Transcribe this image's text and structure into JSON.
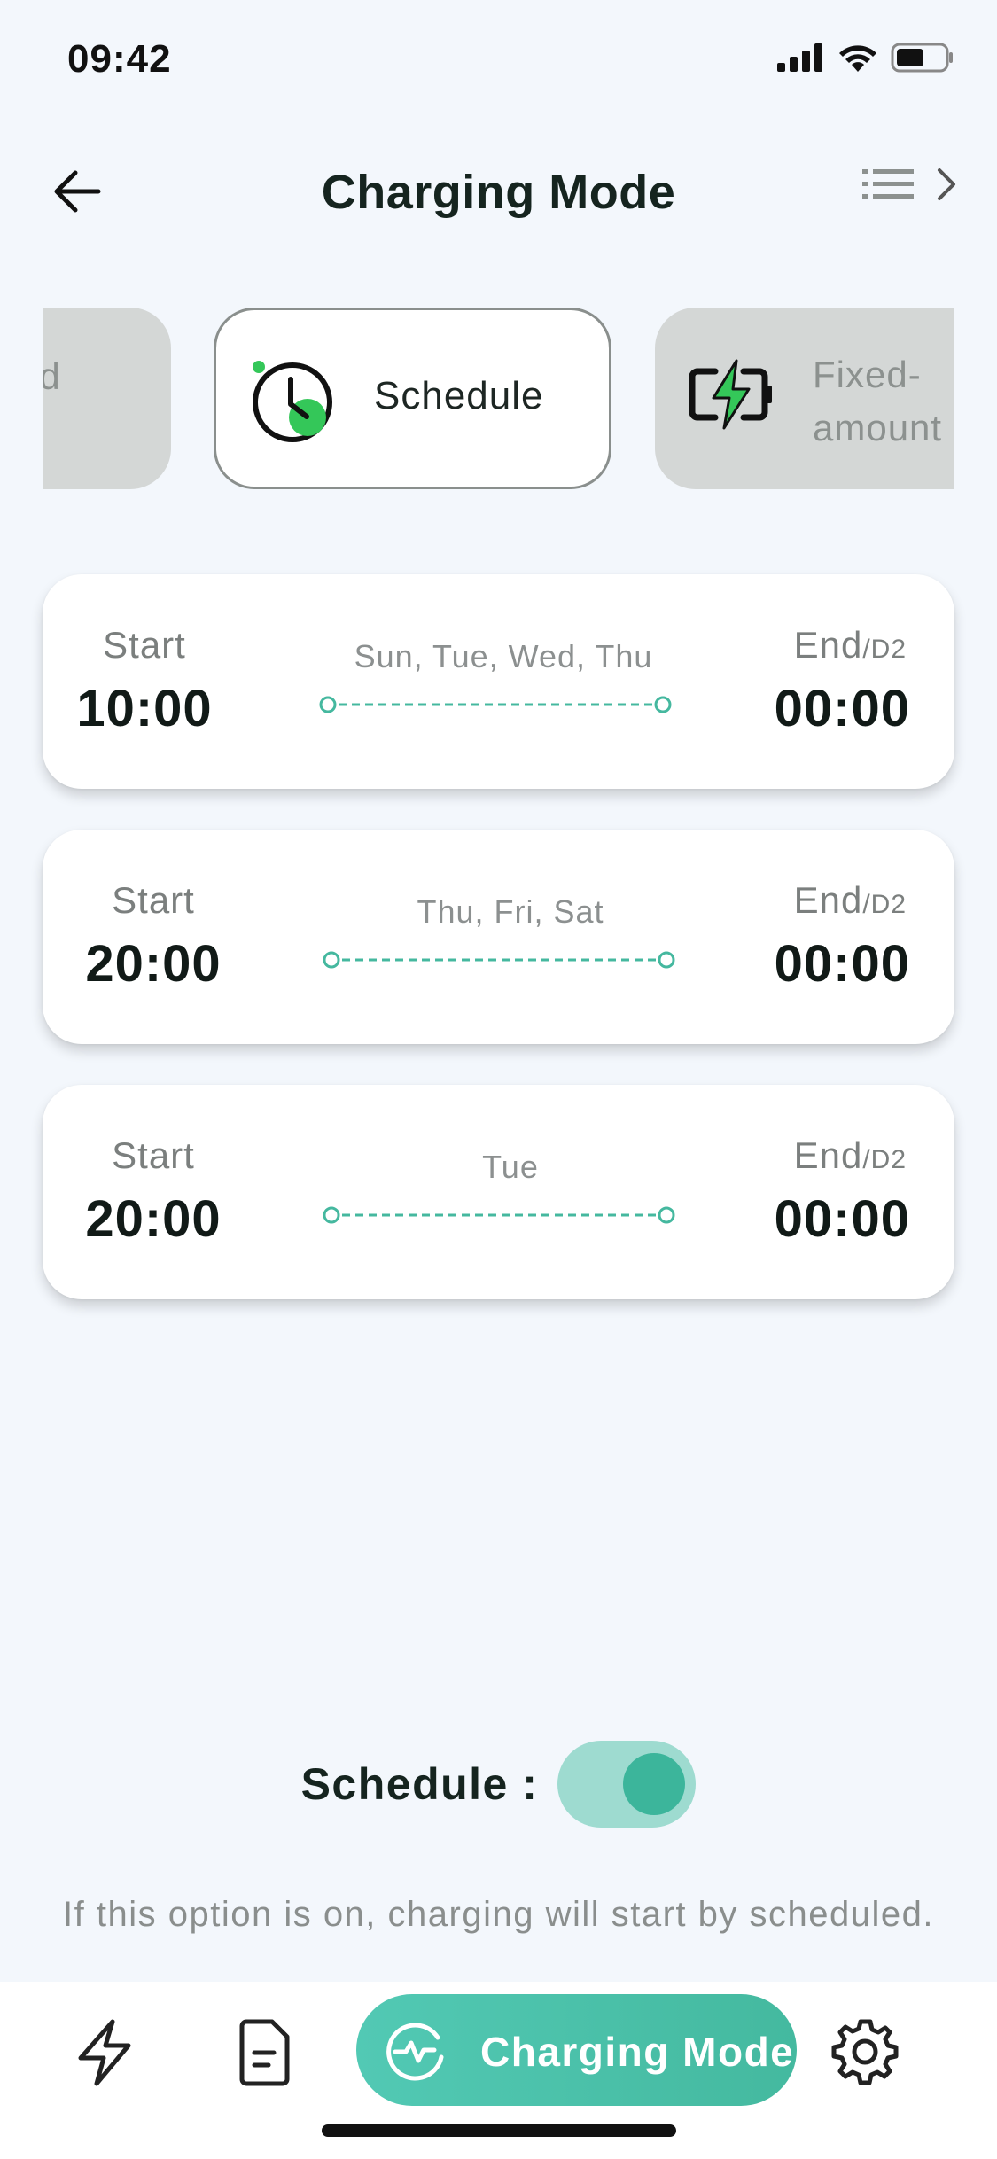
{
  "status_bar": {
    "time": "09:42",
    "icons": [
      "cellular-signal-icon",
      "wifi-icon",
      "battery-icon"
    ]
  },
  "header": {
    "title": "Charging Mode",
    "back_icon": "arrow-left-icon",
    "right_icons": [
      "list-icon",
      "chevron-right-icon"
    ]
  },
  "modes": {
    "previous": {
      "label": "nd\ne"
    },
    "active": {
      "label": "Schedule",
      "icon": "clock-icon"
    },
    "next": {
      "label": "Fixed-\namount",
      "icon": "battery-charging-icon"
    }
  },
  "schedules": [
    {
      "start_label": "Start",
      "start_time": "10:00",
      "days": "Sun, Tue, Wed, Thu",
      "end_label": "End",
      "end_suffix": "/D2",
      "end_time": "00:00"
    },
    {
      "start_label": "Start",
      "start_time": "20:00",
      "days": "Thu, Fri, Sat",
      "end_label": "End",
      "end_suffix": "/D2",
      "end_time": "00:00"
    },
    {
      "start_label": "Start",
      "start_time": "20:00",
      "days": "Tue",
      "end_label": "End",
      "end_suffix": "/D2",
      "end_time": "00:00"
    }
  ],
  "toggle": {
    "label": "Schedule :",
    "state": "on"
  },
  "hint": "If this option is on, charging will start by scheduled.",
  "bottom_nav": {
    "items": [
      {
        "icon": "lightning-icon"
      },
      {
        "icon": "document-icon"
      },
      {
        "icon": "pulse-icon",
        "label": "Charging Mode",
        "active": true
      },
      {
        "icon": "gear-icon"
      }
    ]
  },
  "colors": {
    "accent": "#45b89f",
    "accent_light": "#9edbd0",
    "background": "#f3f7fc",
    "mode_inactive": "#d4d7d6",
    "green_icon": "#34c759"
  }
}
